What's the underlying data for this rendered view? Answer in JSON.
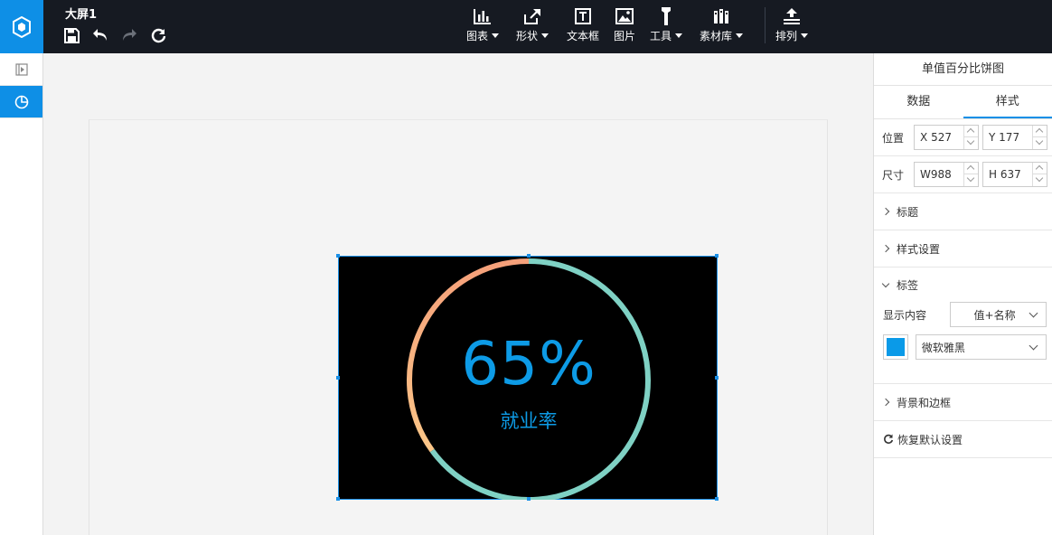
{
  "app": {
    "doc_title": "大屏1"
  },
  "toolbar": {
    "items": [
      {
        "label": "图表",
        "icon": "bar-chart-icon",
        "dropdown": true
      },
      {
        "label": "形状",
        "icon": "shape-icon",
        "dropdown": true
      },
      {
        "label": "文本框",
        "icon": "textbox-icon",
        "dropdown": false
      },
      {
        "label": "图片",
        "icon": "image-icon",
        "dropdown": false
      },
      {
        "label": "工具",
        "icon": "tool-icon",
        "dropdown": true
      },
      {
        "label": "素材库",
        "icon": "library-icon",
        "dropdown": true
      },
      {
        "label": "排列",
        "icon": "arrange-icon",
        "dropdown": true
      }
    ]
  },
  "widget": {
    "value_text": "65%",
    "label_text": "就业率",
    "percent": 0.65,
    "colors": {
      "progress": "#7fd1c4",
      "remainder_start": "#f7b47a",
      "background": "#000000",
      "text": "#0d9be6"
    }
  },
  "panel": {
    "title": "单值百分比饼图",
    "tabs": [
      "数据",
      "样式"
    ],
    "active_tab": "样式",
    "position": {
      "label": "位置",
      "x_prefix": "X",
      "x": "527",
      "y_prefix": "Y",
      "y": "177"
    },
    "size": {
      "label": "尺寸",
      "w_prefix": "W",
      "w": "988",
      "h_prefix": "H",
      "h": "637"
    },
    "sections": {
      "title": "标题",
      "style_settings": "样式设置",
      "labels": "标签",
      "bg_border": "背景和边框",
      "reset": "恢复默认设置"
    },
    "label_settings": {
      "display_label": "显示内容",
      "display_value": "值+名称",
      "font_value": "微软雅黑",
      "color": "#0a9ae8"
    }
  },
  "colors": {
    "accent": "#0e8fe6",
    "topbar": "#161a22"
  }
}
